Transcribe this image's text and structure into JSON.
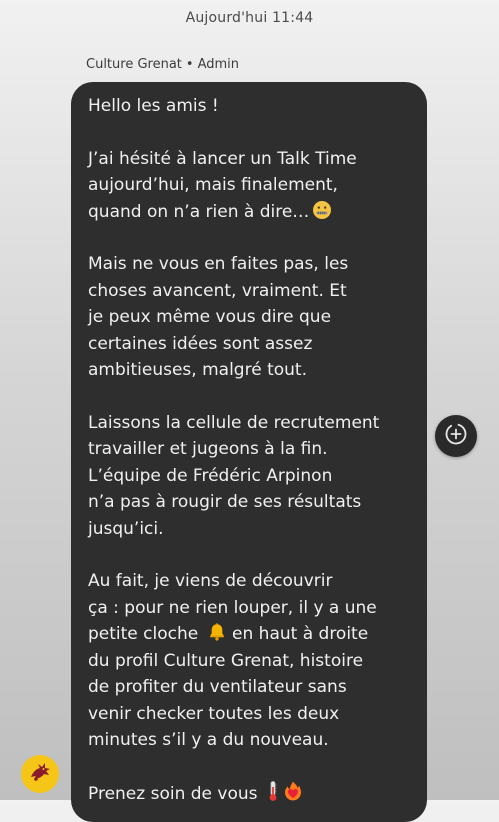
{
  "header": {
    "timestamp": "Aujourd'hui 11:44"
  },
  "message": {
    "sender_name": "Culture Grenat",
    "sender_separator": "•",
    "sender_role": "Admin",
    "paragraphs": {
      "p1": "Hello les amis !",
      "p2": "J’ai hésité à lancer un Talk Time\naujourd’hui, mais finalement,\nquand on n’a rien à dire…",
      "p3": "Mais ne vous en faites pas, les\nchoses avancent, vraiment. Et\nje peux même vous dire que\ncertaines idées sont assez\nambitieuses, malgré tout.",
      "p4": "Laissons la cellule de recrutement\ntravailler et jugeons à la fin.\nL’équipe de Frédéric Arpinon\nn’a pas à rougir de ses résultats\njusqu’ici.",
      "p5_a": "Au fait, je viens de découvrir\nça : pour ne rien louper, il y a une\npetite cloche",
      "p5_b": "en haut à droite\ndu profil Culture Grenat, histoire\nde profiter du ventilateur sans\nvenir checker toutes les deux\nminutes s’il y a du nouveau.",
      "p6": "Prenez soin de vous"
    },
    "emojis": {
      "p2": "zipper-mouth-face",
      "p5": "bell",
      "p6_1": "thermometer",
      "p6_2": "heart-on-fire"
    }
  },
  "actions": {
    "add_reaction_icon": "add-reaction-icon"
  },
  "colors": {
    "bubble": "#2e2e2f",
    "bubble_text": "#f0f0f0",
    "avatar_bg": "#f5c518",
    "avatar_logo": "#8a1c2b"
  }
}
